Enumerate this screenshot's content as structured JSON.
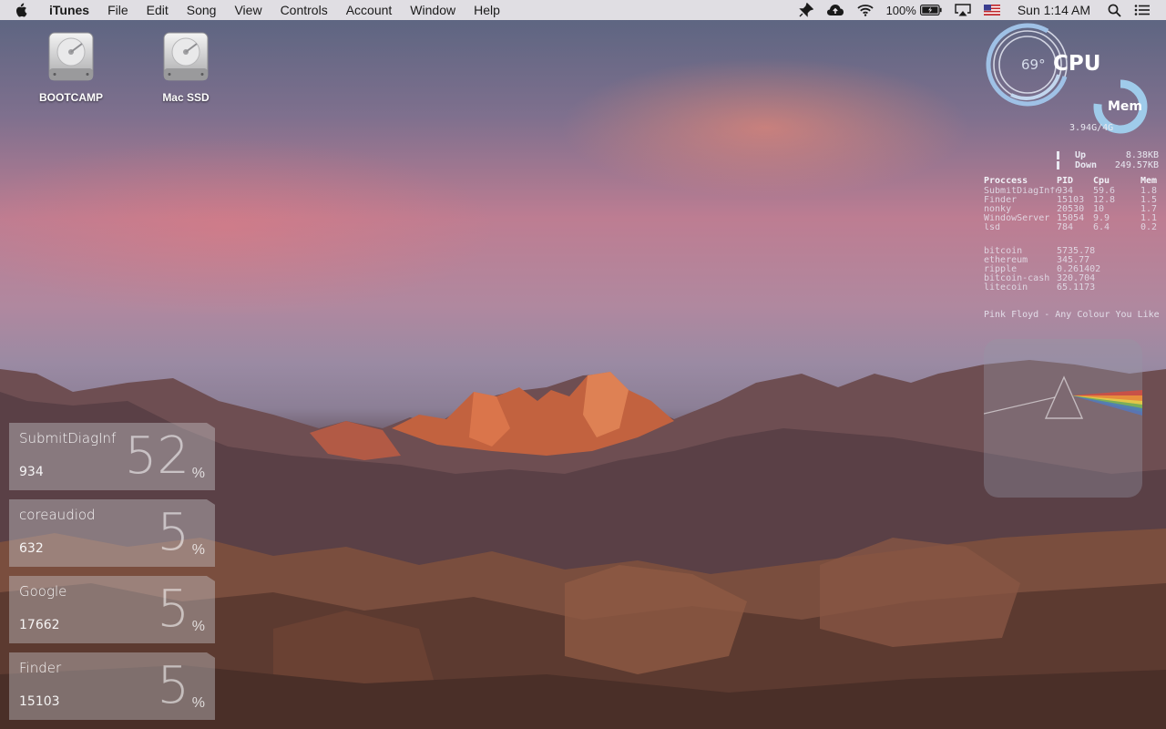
{
  "menubar": {
    "app_name": "iTunes",
    "menus": [
      "File",
      "Edit",
      "Song",
      "View",
      "Controls",
      "Account",
      "Window",
      "Help"
    ],
    "battery_percent": "100%",
    "clock": "Sun 1:14 AM",
    "icons": [
      "apple-icon",
      "pin-icon",
      "cloud-icon",
      "wifi-icon",
      "battery-icon",
      "airplay-icon",
      "us-flag-icon",
      "spotlight-search-icon",
      "notification-center-icon"
    ]
  },
  "desktop": {
    "disks": [
      {
        "label": "BOOTCAMP"
      },
      {
        "label": "Mac SSD"
      }
    ]
  },
  "cpu_widget": {
    "temperature": "69°",
    "cpu_label": "CPU",
    "mem_label": "Mem",
    "mem_value": "3.94G/4G",
    "mem_fraction": 0.985
  },
  "network": {
    "up_label": "Up",
    "up_value": "8.38KB",
    "down_label": "Down",
    "down_value": "249.57KB"
  },
  "processes": {
    "headers": [
      "Proccess",
      "PID",
      "Cpu",
      "Mem"
    ],
    "rows": [
      [
        "SubmitDiagInfo",
        "934",
        "59.6",
        "1.8"
      ],
      [
        "Finder",
        "15103",
        "12.8",
        "1.5"
      ],
      [
        "nonky",
        "20530",
        "10",
        "1.7"
      ],
      [
        "WindowServer",
        "15054",
        "9.9",
        "1.1"
      ],
      [
        "lsd",
        "784",
        "6.4",
        "0.2"
      ]
    ]
  },
  "crypto": [
    {
      "name": "bitcoin",
      "value": "5735.78"
    },
    {
      "name": "ethereum",
      "value": "345.77"
    },
    {
      "name": "ripple",
      "value": "0.261402"
    },
    {
      "name": "bitcoin-cash",
      "value": "320.704"
    },
    {
      "name": "litecoin",
      "value": "65.1173"
    }
  ],
  "now_playing": "Pink Floyd - Any Colour You Like",
  "top_processes": [
    {
      "name": "SubmitDiagInf",
      "pid": "934",
      "percent": "52",
      "sign": "%"
    },
    {
      "name": "coreaudiod",
      "pid": "632",
      "percent": "5",
      "sign": "%"
    },
    {
      "name": "Google",
      "pid": "17662",
      "percent": "5",
      "sign": "%"
    },
    {
      "name": "Finder",
      "pid": "15103",
      "percent": "5",
      "sign": "%"
    }
  ]
}
